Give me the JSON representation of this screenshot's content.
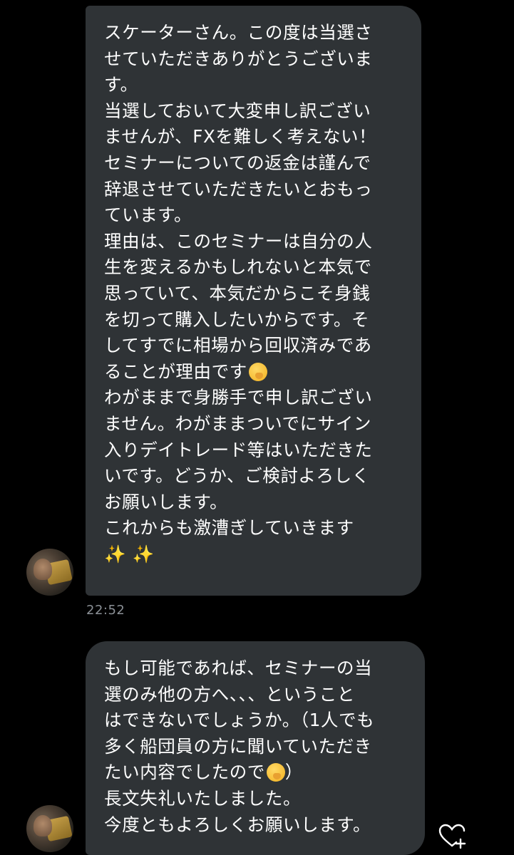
{
  "messages": [
    {
      "lines": [
        "スケーターさん。この度は当選さ",
        "せていただきありがとうございま",
        "す。",
        "当選しておいて大変申し訳ござい",
        "ませんが、FXを難しく考えない！",
        "セミナーについての返金は謹んで",
        "辞退させていただきたいとおもっ",
        "ています。",
        "理由は、このセミナーは自分の人",
        "生を変えるかもしれないと本気で",
        "思っていて、本気だからこそ身銭",
        "を切って購入したいからです。そ",
        "してすでに相場から回収済みであ",
        "ることが理由です",
        "わがままで身勝手で申し訳ござい",
        "ません。わがままついでにサイン",
        "入りデイトレード等はいただきた",
        "いです。どうか、ご検討よろしく",
        "お願いします。",
        "これからも激漕ぎしていきます"
      ],
      "emoji_face": "🤭",
      "sparkles": "✨ ✨",
      "timestamp": "22:52"
    },
    {
      "lines": [
        "もし可能であれば、セミナーの当",
        "選のみ他の方へ、、、ということ",
        "はできないでしょうか。（1人でも",
        "多く船団員の方に聞いていただき",
        "たい内容でしたので",
        "長文失礼いたしました。",
        "今度ともよろしくお願いします。"
      ],
      "emoji_face": "🤭",
      "closing_paren": "）"
    }
  ],
  "icons": {
    "avatar": "user-avatar",
    "reaction": "heart-plus-icon"
  },
  "colors": {
    "background": "#000000",
    "bubble": "#2f3336",
    "text": "#ffffff",
    "timestamp": "#8b9096"
  }
}
